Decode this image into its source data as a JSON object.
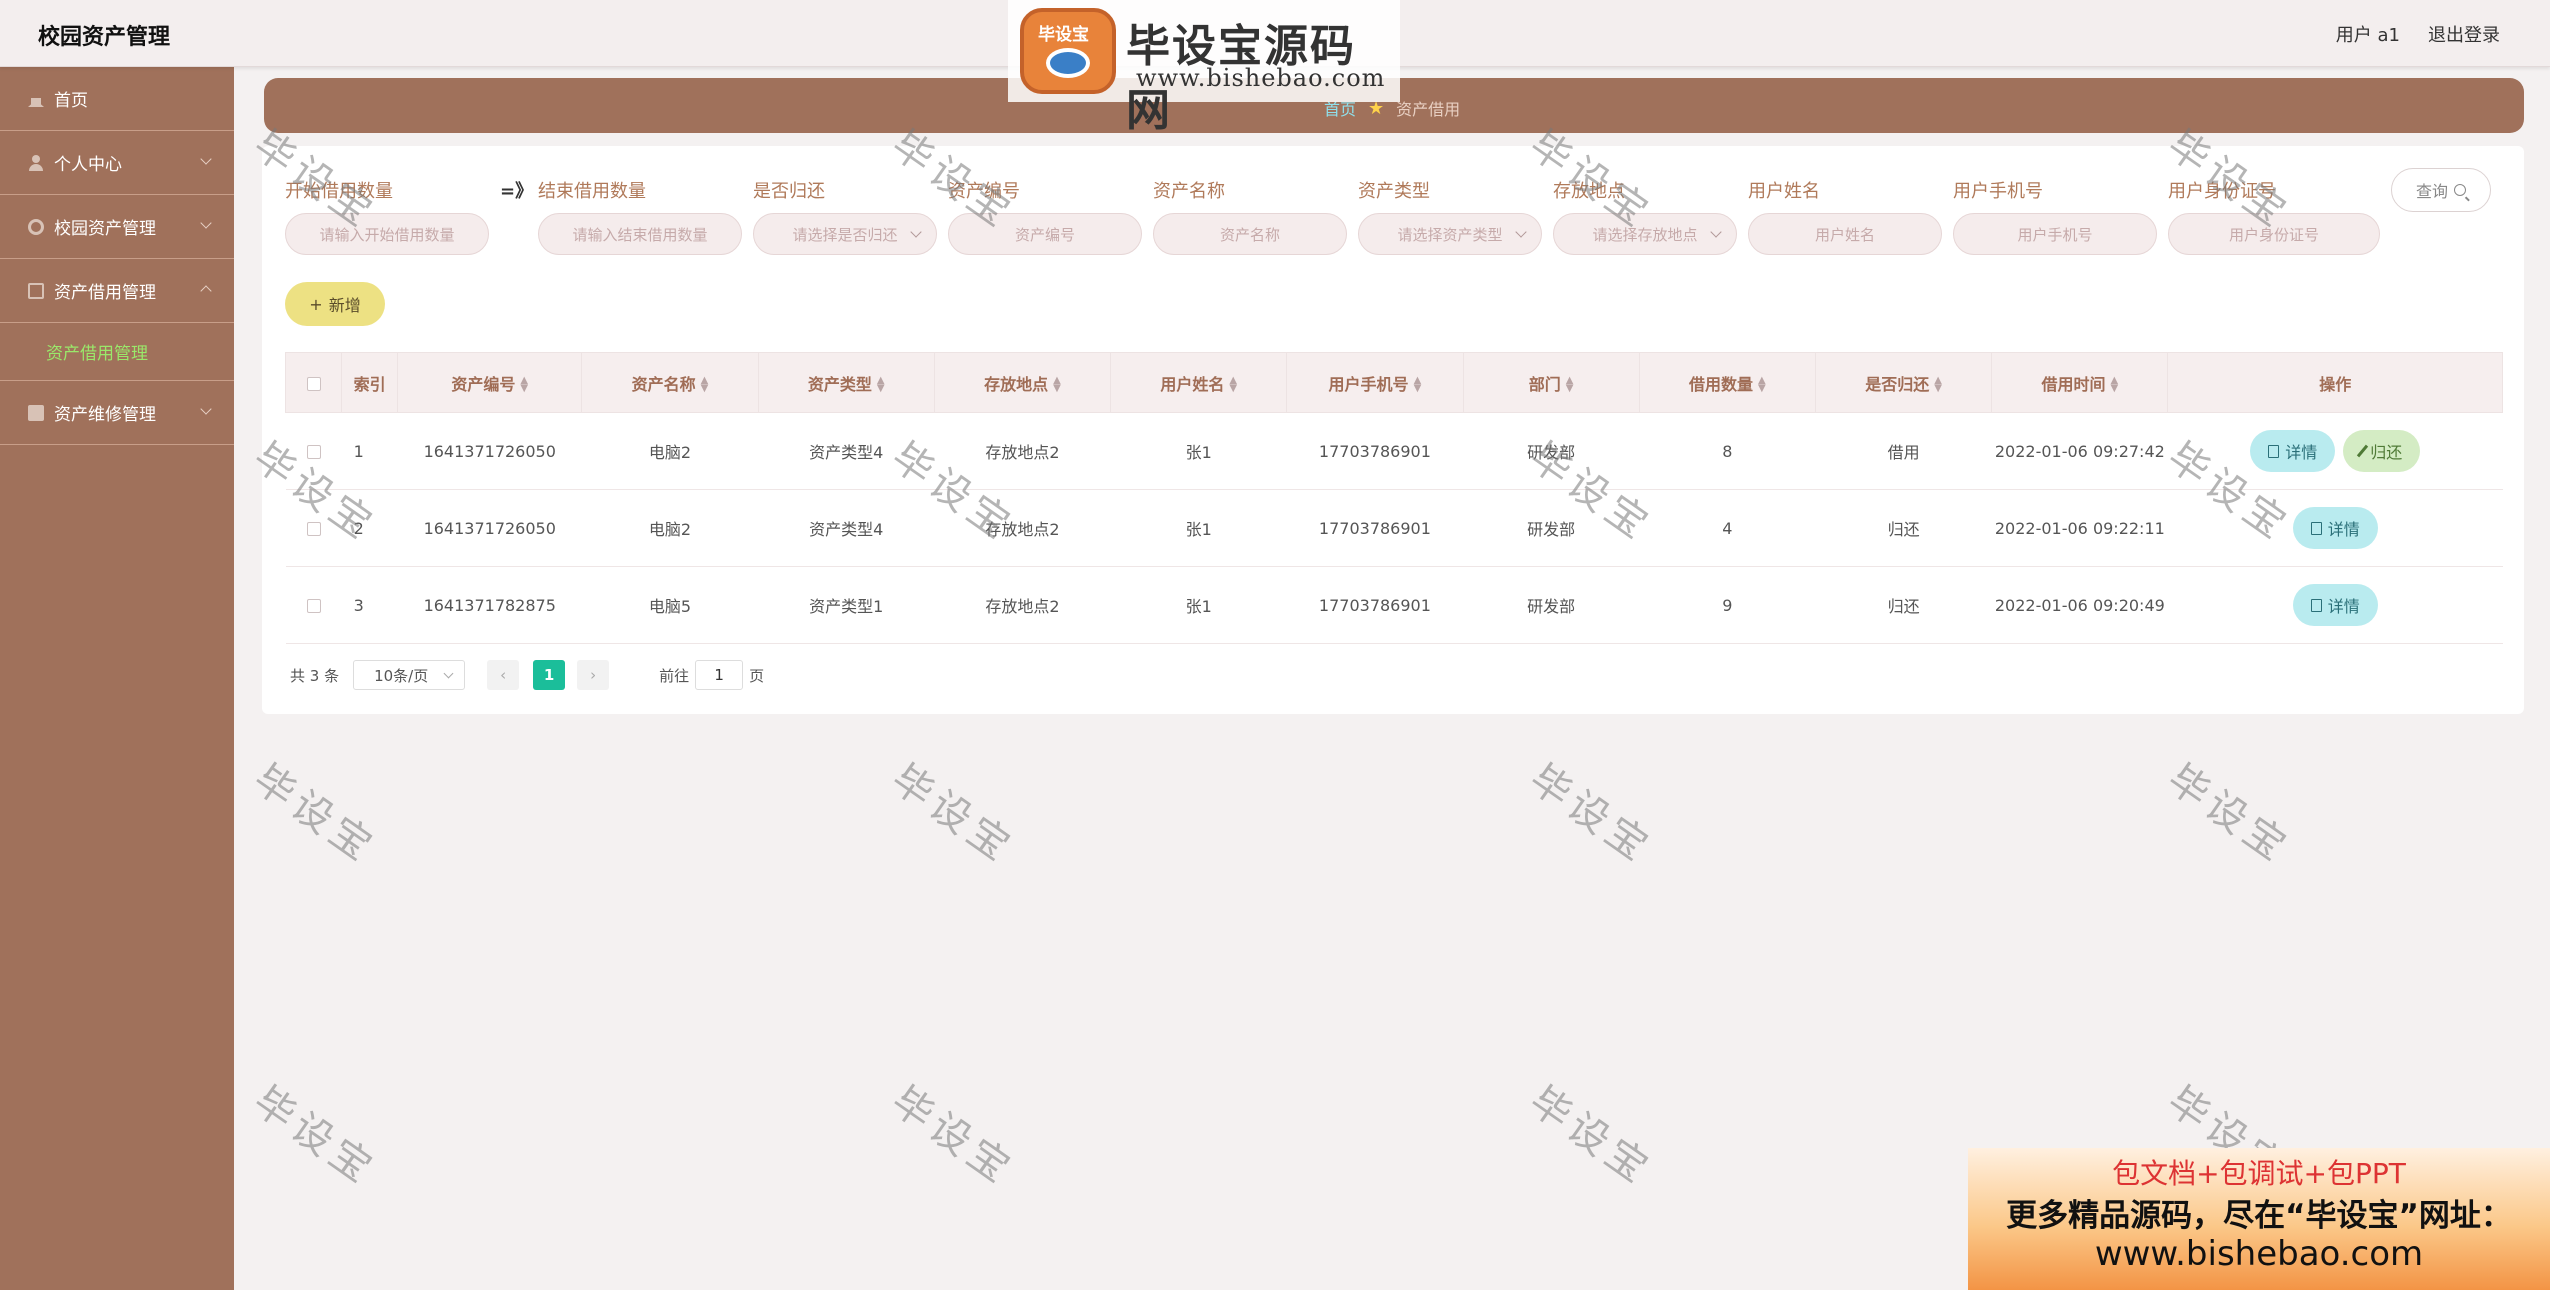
{
  "header": {
    "app_title": "校园资产管理",
    "user_label": "用户 a1",
    "logout_label": "退出登录"
  },
  "top_logo": {
    "badge_text": "毕设宝",
    "main_text": "毕设宝源码网",
    "url_text": "www.bishebao.com"
  },
  "sidebar": {
    "items": [
      {
        "label": "首页",
        "icon": "home-icon"
      },
      {
        "label": "个人中心",
        "icon": "user-icon"
      },
      {
        "label": "校园资产管理",
        "icon": "gear-icon"
      },
      {
        "label": "资产借用管理",
        "icon": "doc-icon"
      },
      {
        "label": "资产维修管理",
        "icon": "box-icon"
      }
    ],
    "sub_item": "资产借用管理"
  },
  "breadcrumb": {
    "home": "首页",
    "current": "资产借用"
  },
  "search": {
    "fields": [
      {
        "label": "开始借用数量",
        "placeholder": "请输入开始借用数量"
      },
      {
        "label": "结束借用数量",
        "placeholder": "请输入结束借用数量"
      },
      {
        "label": "是否归还",
        "placeholder": "请选择是否归还"
      },
      {
        "label": "资产编号",
        "placeholder": "资产编号"
      },
      {
        "label": "资产名称",
        "placeholder": "资产名称"
      },
      {
        "label": "资产类型",
        "placeholder": "请选择资产类型"
      },
      {
        "label": "存放地点",
        "placeholder": "请选择存放地点"
      },
      {
        "label": "用户姓名",
        "placeholder": "用户姓名"
      },
      {
        "label": "用户手机号",
        "placeholder": "用户手机号"
      },
      {
        "label": "用户身份证号",
        "placeholder": "用户身份证号"
      }
    ],
    "range_arrow": "=》",
    "query_label": "查询"
  },
  "toolbar": {
    "add_label": "新增"
  },
  "table": {
    "columns": [
      "索引",
      "资产编号",
      "资产名称",
      "资产类型",
      "存放地点",
      "用户姓名",
      "用户手机号",
      "部门",
      "借用数量",
      "是否归还",
      "借用时间",
      "操作"
    ],
    "rows": [
      {
        "index": "1",
        "asset_no": "1641371726050",
        "asset_name": "电脑2",
        "asset_type": "资产类型4",
        "location": "存放地点2",
        "user": "张1",
        "phone": "17703786901",
        "dept": "研发部",
        "qty": "8",
        "returned": "借用",
        "time": "2022-01-06 09:27:42"
      },
      {
        "index": "2",
        "asset_no": "1641371726050",
        "asset_name": "电脑2",
        "asset_type": "资产类型4",
        "location": "存放地点2",
        "user": "张1",
        "phone": "17703786901",
        "dept": "研发部",
        "qty": "4",
        "returned": "归还",
        "time": "2022-01-06 09:22:11"
      },
      {
        "index": "3",
        "asset_no": "1641371782875",
        "asset_name": "电脑5",
        "asset_type": "资产类型1",
        "location": "存放地点2",
        "user": "张1",
        "phone": "17703786901",
        "dept": "研发部",
        "qty": "9",
        "returned": "归还",
        "time": "2022-01-06 09:20:49"
      }
    ],
    "detail_label": "详情",
    "return_label": "归还"
  },
  "pagination": {
    "total": "共 3 条",
    "page_size": "10条/页",
    "current_page": "1",
    "goto_prefix": "前往",
    "goto_value": "1",
    "goto_suffix": "页"
  },
  "watermark": "毕设宝",
  "ad": {
    "line1": "包文档+包调试+包PPT",
    "line2": "更多精品源码，尽在“毕设宝”网址：",
    "line3": "www.bishebao.com"
  },
  "colors": {
    "sidebar": "#a0715b",
    "active_submenu": "#9ae86a",
    "detail_button": "#b9ebef",
    "return_button": "#d4ecc4",
    "add_button": "#ede183",
    "pager_active": "#1bbe9a"
  }
}
